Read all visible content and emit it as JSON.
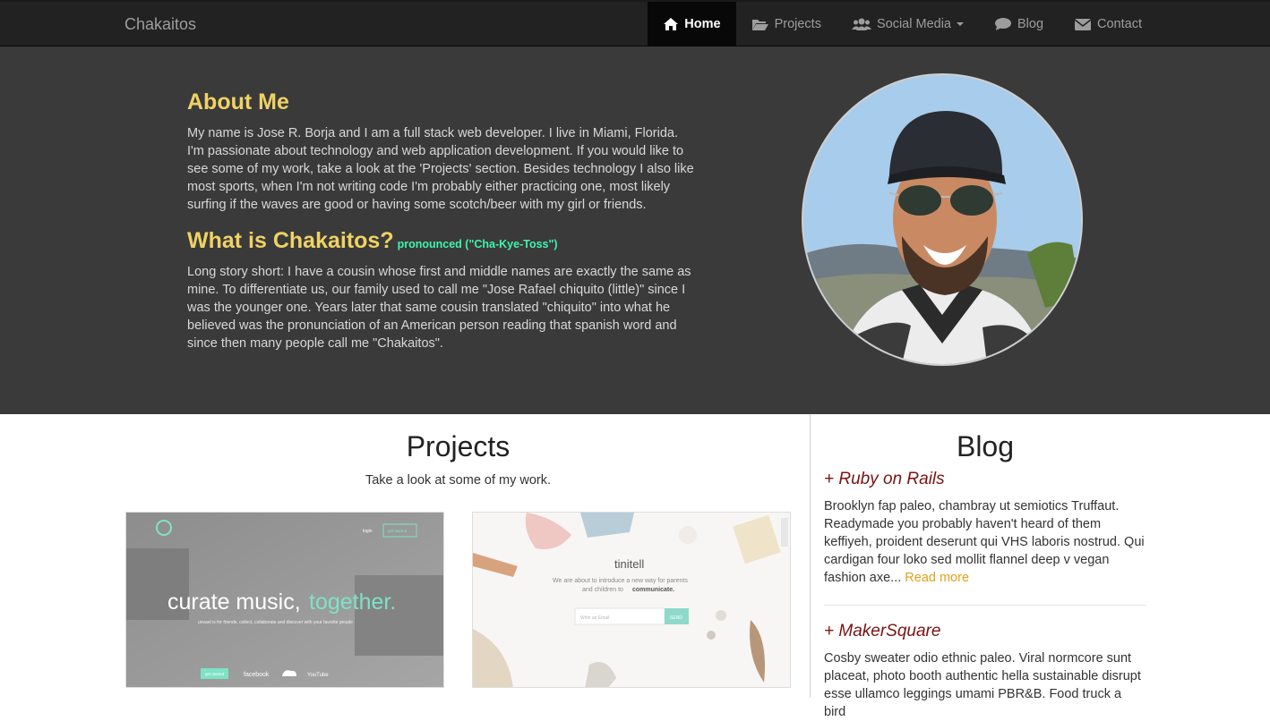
{
  "navbar": {
    "brand": "Chakaitos",
    "items": [
      {
        "label": "Home",
        "icon": "home-icon"
      },
      {
        "label": "Projects",
        "icon": "folder-open-icon"
      },
      {
        "label": "Social Media",
        "icon": "users-icon"
      },
      {
        "label": "Blog",
        "icon": "comment-icon"
      },
      {
        "label": "Contact",
        "icon": "envelope-icon"
      }
    ]
  },
  "about": {
    "title": "About Me",
    "body": "My name is Jose R. Borja and I am a full stack web developer. I live in Miami, Florida. I'm passionate about technology and web application development. If you would like to see some of my work, take a look at the 'Projects' section. Besides technology I also like most sports, when I'm not writing code I'm probably either practicing one, most likely surfing if the waves are good or having some scotch/beer with my girl or friends.",
    "what_title": "What is Chakaitos?",
    "pronounced": "pronounced (\"Cha-Kye-Toss\")",
    "what_body": "Long story short: I have a cousin whose first and middle names are exactly the same as mine. To differentiate us, our family used to call me \"Jose Rafael chiquito (little)\" since I was the younger one. Years later that same cousin translated \"chiquito\" into what he believed was the pronunciation of an American person reading that spanish word and since then many people call me \"Chakaitos\"."
  },
  "projects": {
    "title": "Projects",
    "subtitle": "Take a look at some of my work.",
    "thumbs": [
      {
        "login": "login",
        "cta": "get started",
        "headline_a": "curate music,",
        "headline_b": "together.",
        "tagline": "unvael is for friends. collect, collaborate and discover with your favorite people",
        "btn": "get started",
        "brands": [
          "facebook",
          "YouTube"
        ]
      },
      {
        "name": "tinitell",
        "line1": "We are about to introduce a new way for parents",
        "line2": "and children to",
        "line2_bold": "communicate.",
        "email_placeholder": "Write an Email",
        "send": "SEND"
      }
    ]
  },
  "blog": {
    "title": "Blog",
    "posts": [
      {
        "title": "+ Ruby on Rails",
        "body": "Brooklyn fap paleo, chambray ut semiotics Truffaut. Readymade you probably haven't heard of them keffiyeh, proident deserunt qui VHS laboris nostrud. Qui cardigan four loko sed mollit flannel deep v vegan fashion axe...",
        "more": "Read more"
      },
      {
        "title": "+ MakerSquare",
        "body": "Cosby sweater odio ethnic paleo. Viral normcore sunt placeat, photo booth authentic hella sustainable disrupt esse ullamco leggings umami PBR&B. Food truck a bird"
      }
    ]
  },
  "colors": {
    "navbar_bg": "#222222",
    "hero_bg": "#3a3a3a",
    "heading_yellow": "#f0d264",
    "pronounced_green": "#3ff3b1",
    "blog_title_red": "#7a1212",
    "read_more": "#e0a21a"
  }
}
